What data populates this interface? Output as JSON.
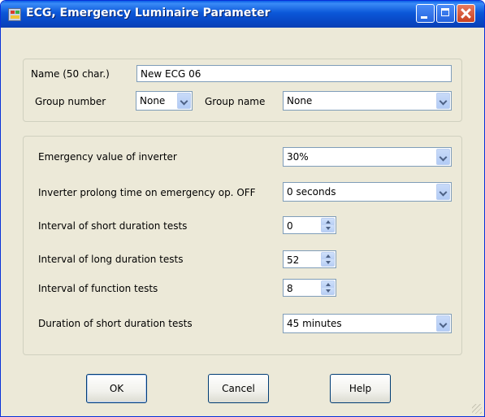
{
  "window": {
    "title": "ECG, Emergency Luminaire Parameter"
  },
  "identity": {
    "name_label": "Name (50 char.)",
    "name_value": "New ECG 06",
    "group_number_label": "Group number",
    "group_number_value": "None",
    "group_name_label": "Group name",
    "group_name_value": "None"
  },
  "parameters": {
    "emergency_value": {
      "label": "Emergency value of inverter",
      "value": "30%"
    },
    "prolong_time": {
      "label": "Inverter prolong time on emergency op. OFF",
      "value": "0 seconds"
    },
    "short_tests": {
      "label": "Interval of short duration tests",
      "value": "0"
    },
    "long_tests": {
      "label": "Interval of long duration tests",
      "value": "52"
    },
    "function_tests": {
      "label": "Interval of function tests",
      "value": "8"
    },
    "short_duration": {
      "label": "Duration of short duration tests",
      "value": "45 minutes"
    }
  },
  "buttons": {
    "ok": "OK",
    "cancel": "Cancel",
    "help": "Help"
  },
  "icons": {
    "app": "app-icon",
    "minimize": "minimize-icon",
    "maximize": "maximize-icon",
    "close": "close-icon",
    "dropdown": "chevron-down-icon",
    "spin_up": "spin-up-icon",
    "spin_down": "spin-down-icon",
    "resize": "resize-grip-icon"
  },
  "colors": {
    "titlebar": "#0b57d8",
    "dialog_bg": "#ece9d8",
    "close_button": "#c84121",
    "field_border": "#7f9db9"
  }
}
